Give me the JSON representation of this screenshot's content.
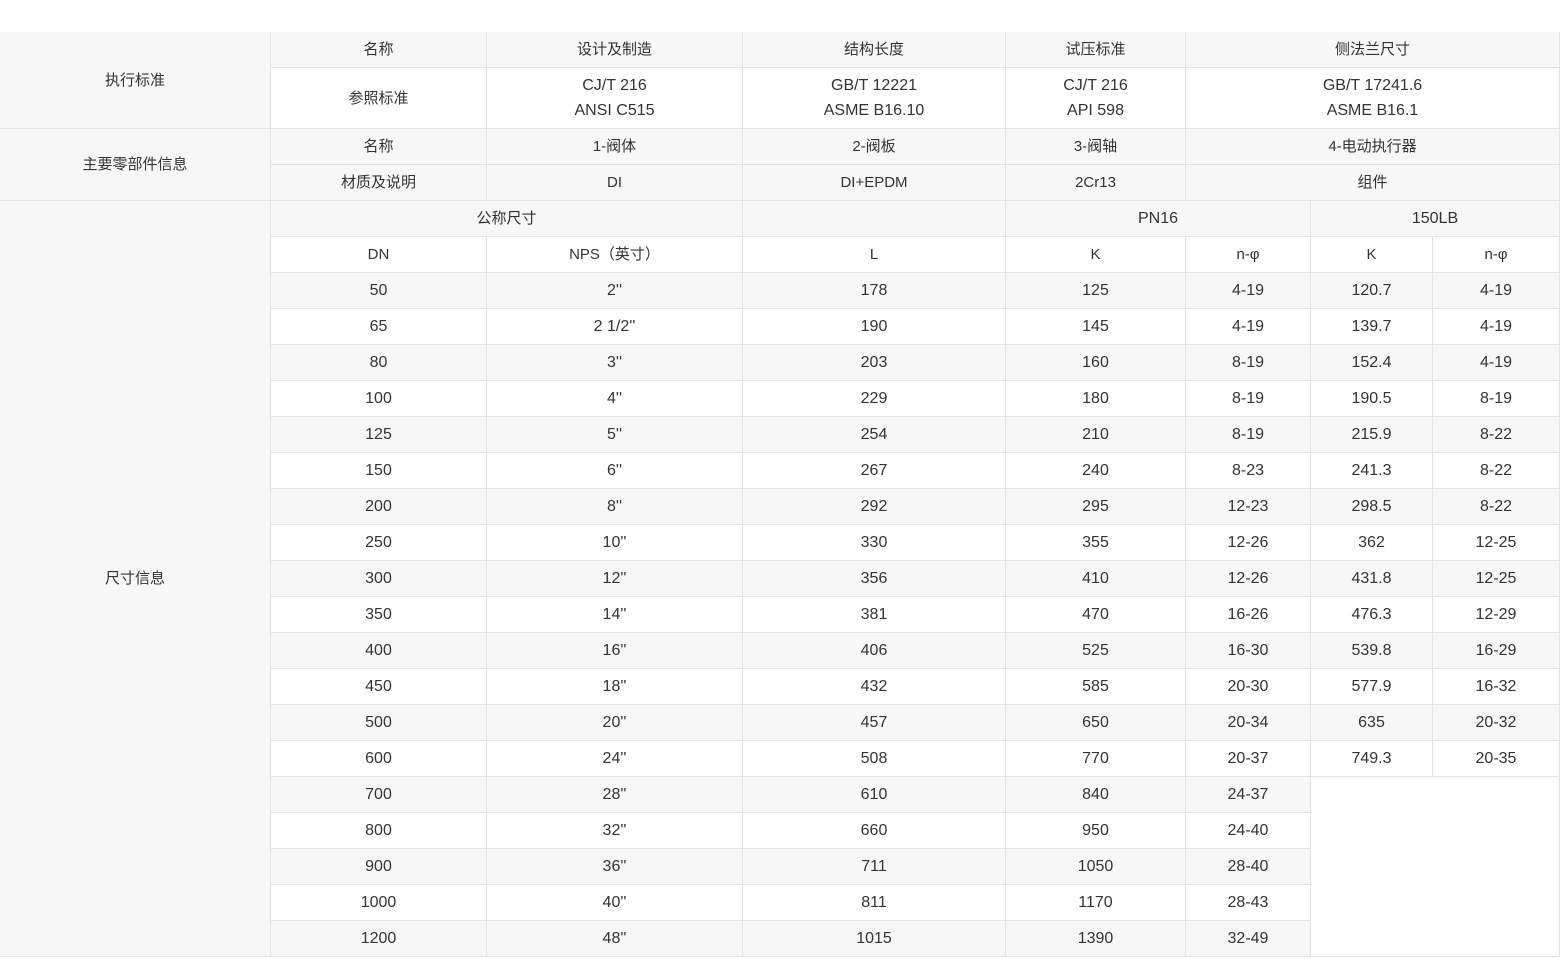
{
  "colors": {
    "border": "#e2e2e2",
    "row_shade": "#f7f7f7",
    "text": "#333333"
  },
  "table": {
    "sections": {
      "standards": "执行标准",
      "parts": "主要零部件信息",
      "dimensions": "尺寸信息"
    },
    "standards": {
      "header": [
        "名称",
        "设计及制造",
        "结构长度",
        "试压标准",
        "侧法兰尺寸"
      ],
      "reference": {
        "label": "参照标准",
        "cells": [
          [
            "CJ/T 216",
            "ANSI C515"
          ],
          [
            "GB/T 12221",
            "ASME B16.10"
          ],
          [
            "CJ/T 216",
            "API 598"
          ],
          [
            "GB/T 17241.6",
            "ASME B16.1"
          ]
        ]
      }
    },
    "parts": {
      "names": [
        "名称",
        "1-阀体",
        "2-阀板",
        "3-阀轴",
        "4-电动执行器"
      ],
      "materials": [
        "材质及说明",
        "DI",
        "DI+EPDM",
        "2Cr13",
        "组件"
      ]
    },
    "dimensions": {
      "group_header": {
        "nominal": "公称尺寸",
        "length": "",
        "pn16": "PN16",
        "lb150": "150LB"
      },
      "columns": [
        "DN",
        "NPS（英寸）",
        "L",
        "K",
        "n-φ",
        "K",
        "n-φ"
      ],
      "rows": [
        [
          "50",
          "2''",
          "178",
          "125",
          "4-19",
          "120.7",
          "4-19"
        ],
        [
          "65",
          "2  1/2''",
          "190",
          "145",
          "4-19",
          "139.7",
          "4-19"
        ],
        [
          "80",
          "3''",
          "203",
          "160",
          "8-19",
          "152.4",
          "4-19"
        ],
        [
          "100",
          "4''",
          "229",
          "180",
          "8-19",
          "190.5",
          "8-19"
        ],
        [
          "125",
          "5''",
          "254",
          "210",
          "8-19",
          "215.9",
          "8-22"
        ],
        [
          "150",
          "6''",
          "267",
          "240",
          "8-23",
          "241.3",
          "8-22"
        ],
        [
          "200",
          "8''",
          "292",
          "295",
          "12-23",
          "298.5",
          "8-22"
        ],
        [
          "250",
          "10''",
          "330",
          "355",
          "12-26",
          "362",
          "12-25"
        ],
        [
          "300",
          "12''",
          "356",
          "410",
          "12-26",
          "431.8",
          "12-25"
        ],
        [
          "350",
          "14''",
          "381",
          "470",
          "16-26",
          "476.3",
          "12-29"
        ],
        [
          "400",
          "16''",
          "406",
          "525",
          "16-30",
          "539.8",
          "16-29"
        ],
        [
          "450",
          "18''",
          "432",
          "585",
          "20-30",
          "577.9",
          "16-32"
        ],
        [
          "500",
          "20''",
          "457",
          "650",
          "20-34",
          "635",
          "20-32"
        ],
        [
          "600",
          "24''",
          "508",
          "770",
          "20-37",
          "749.3",
          "20-35"
        ],
        [
          "700",
          "28''",
          "610",
          "840",
          "24-37"
        ],
        [
          "800",
          "32''",
          "660",
          "950",
          "24-40"
        ],
        [
          "900",
          "36''",
          "711",
          "1050",
          "28-40"
        ],
        [
          "1000",
          "40''",
          "811",
          "1170",
          "28-43"
        ],
        [
          "1200",
          "48''",
          "1015",
          "1390",
          "32-49"
        ]
      ]
    }
  }
}
